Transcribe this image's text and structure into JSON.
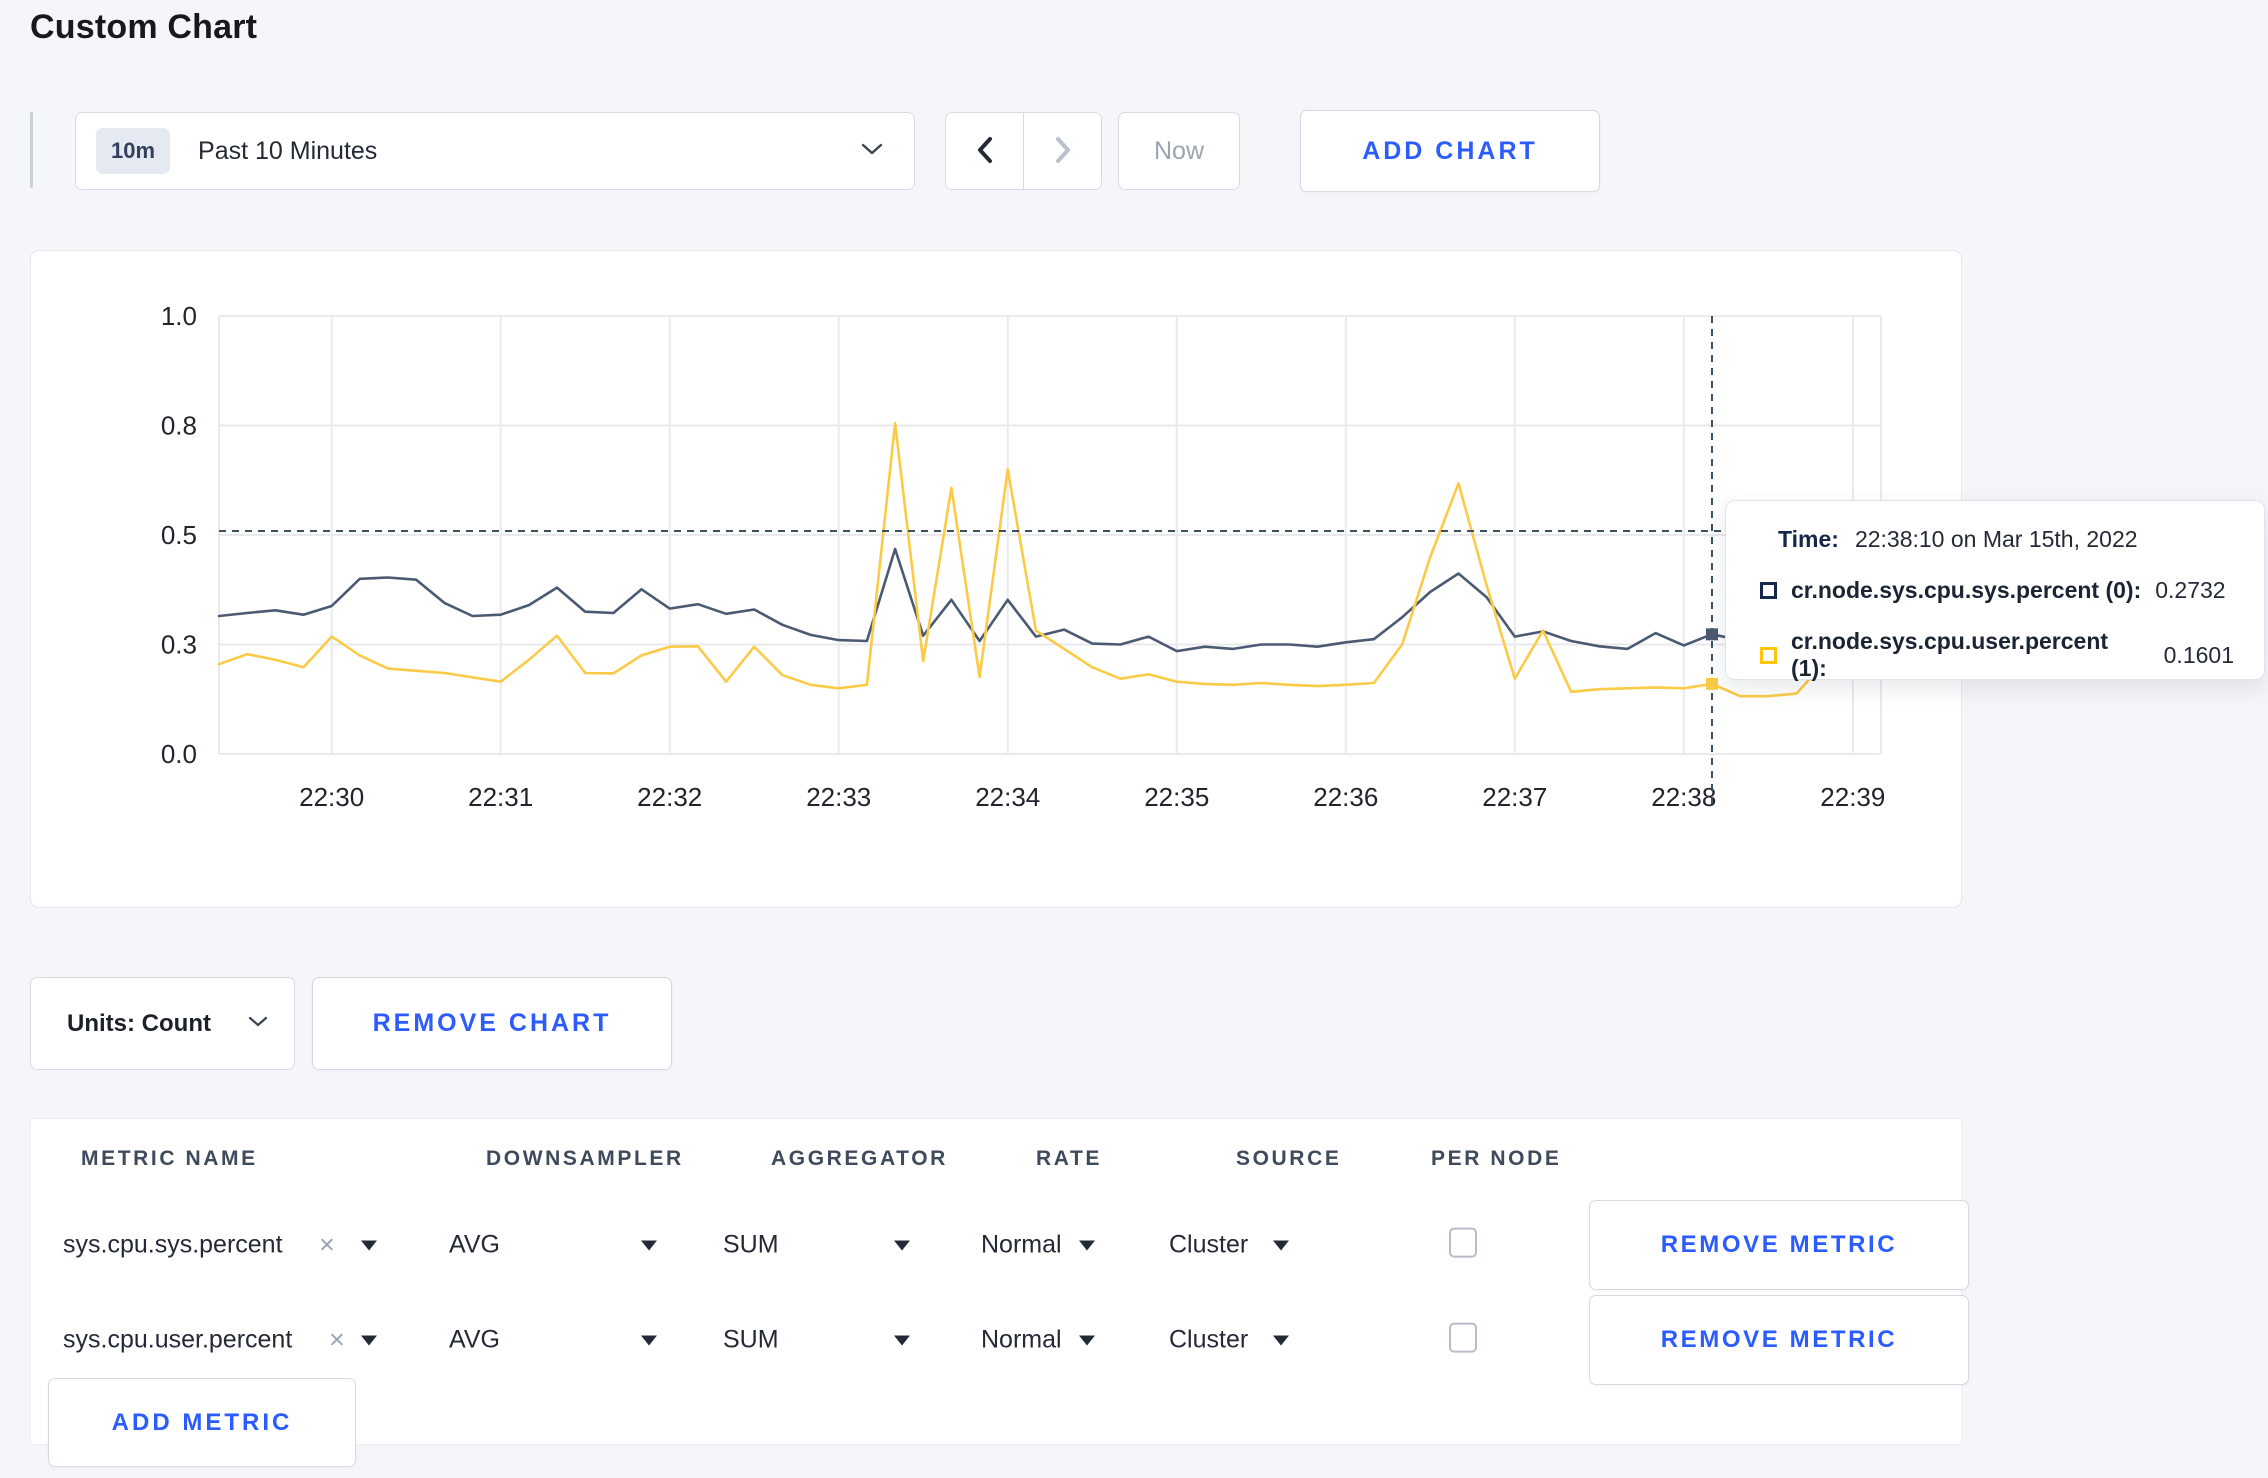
{
  "page": {
    "title": "Custom Chart",
    "background": "#f5f6fa",
    "accent_blue": "#2c5cff"
  },
  "toolbar": {
    "time_range": {
      "badge": "10m",
      "label": "Past 10 Minutes"
    },
    "now_label": "Now",
    "add_chart_label": "ADD CHART"
  },
  "chart_data": {
    "type": "line",
    "title": "",
    "xlabel": "",
    "ylabel": "",
    "grid": true,
    "legend_position": "tooltip",
    "x_axis": {
      "start_time": "22:29:20",
      "step_seconds": 10,
      "domain_s": [
        0,
        590
      ],
      "tick_offsets_s": [
        40,
        100,
        160,
        220,
        280,
        340,
        400,
        460,
        520,
        580
      ],
      "tick_labels": [
        "22:30",
        "22:31",
        "22:32",
        "22:33",
        "22:34",
        "22:35",
        "22:36",
        "22:37",
        "22:38",
        "22:39"
      ]
    },
    "y_axis": {
      "domain": [
        0,
        1
      ],
      "ticks": [
        {
          "value": 0,
          "label": "0.0"
        },
        {
          "value": 0.25,
          "label": "0.3"
        },
        {
          "value": 0.5,
          "label": "0.5"
        },
        {
          "value": 0.75,
          "label": "0.8"
        },
        {
          "value": 1,
          "label": "1.0"
        }
      ]
    },
    "series": [
      {
        "name": "cr.node.sys.cpu.sys.percent",
        "color": "#4b5a73",
        "values": [
          0.315,
          0.322,
          0.328,
          0.318,
          0.338,
          0.4,
          0.403,
          0.398,
          0.345,
          0.315,
          0.318,
          0.34,
          0.38,
          0.325,
          0.322,
          0.376,
          0.332,
          0.342,
          0.32,
          0.33,
          0.295,
          0.272,
          0.26,
          0.258,
          0.468,
          0.27,
          0.352,
          0.258,
          0.352,
          0.268,
          0.284,
          0.252,
          0.25,
          0.268,
          0.235,
          0.245,
          0.24,
          0.25,
          0.25,
          0.245,
          0.255,
          0.262,
          0.312,
          0.37,
          0.412,
          0.358,
          0.268,
          0.28,
          0.258,
          0.246,
          0.24,
          0.276,
          0.248,
          0.2732,
          0.26,
          0.268,
          0.272,
          0.284,
          0.296,
          0.3
        ]
      },
      {
        "name": "cr.node.sys.cpu.user.percent",
        "color": "#fbcb47",
        "values": [
          0.205,
          0.228,
          0.215,
          0.198,
          0.268,
          0.225,
          0.195,
          0.19,
          0.185,
          0.175,
          0.165,
          0.215,
          0.27,
          0.185,
          0.184,
          0.225,
          0.245,
          0.246,
          0.165,
          0.245,
          0.18,
          0.158,
          0.15,
          0.158,
          0.755,
          0.212,
          0.608,
          0.176,
          0.65,
          0.282,
          0.24,
          0.198,
          0.172,
          0.182,
          0.165,
          0.16,
          0.158,
          0.162,
          0.158,
          0.155,
          0.158,
          0.162,
          0.25,
          0.45,
          0.618,
          0.385,
          0.172,
          0.282,
          0.142,
          0.148,
          0.15,
          0.152,
          0.15,
          0.1601,
          0.132,
          0.132,
          0.138,
          0.21,
          0.285,
          0.26
        ]
      }
    ],
    "crosshair": {
      "x_offset_s": 530,
      "y_value": 0.509,
      "color": "#3b5161"
    },
    "grid_color": "#e8eaee",
    "axis_label_color": "#20252c"
  },
  "tooltip": {
    "time_key": "Time:",
    "time_value": "22:38:10 on Mar 15th, 2022",
    "rows": [
      {
        "name": "cr.node.sys.cpu.sys.percent (0):",
        "value": "0.2732",
        "color": "#152849"
      },
      {
        "name": "cr.node.sys.cpu.user.percent (1):",
        "value": "0.1601",
        "color": "#ffc40c"
      }
    ]
  },
  "chart_controls": {
    "units_label": "Units: Count",
    "remove_chart_label": "REMOVE CHART"
  },
  "metrics_table": {
    "headers": [
      "METRIC NAME",
      "DOWNSAMPLER",
      "AGGREGATOR",
      "RATE",
      "SOURCE",
      "PER NODE"
    ],
    "rows": [
      {
        "metric": "sys.cpu.sys.percent",
        "remove_glyph": "×",
        "downsampler": "AVG",
        "aggregator": "SUM",
        "rate": "Normal",
        "source": "Cluster",
        "per_node_checked": false,
        "remove_label": "REMOVE METRIC"
      },
      {
        "metric": "sys.cpu.user.percent",
        "remove_glyph": "×",
        "downsampler": "AVG",
        "aggregator": "SUM",
        "rate": "Normal",
        "source": "Cluster",
        "per_node_checked": false,
        "remove_label": "REMOVE METRIC"
      }
    ],
    "add_metric_label": "ADD METRIC"
  }
}
